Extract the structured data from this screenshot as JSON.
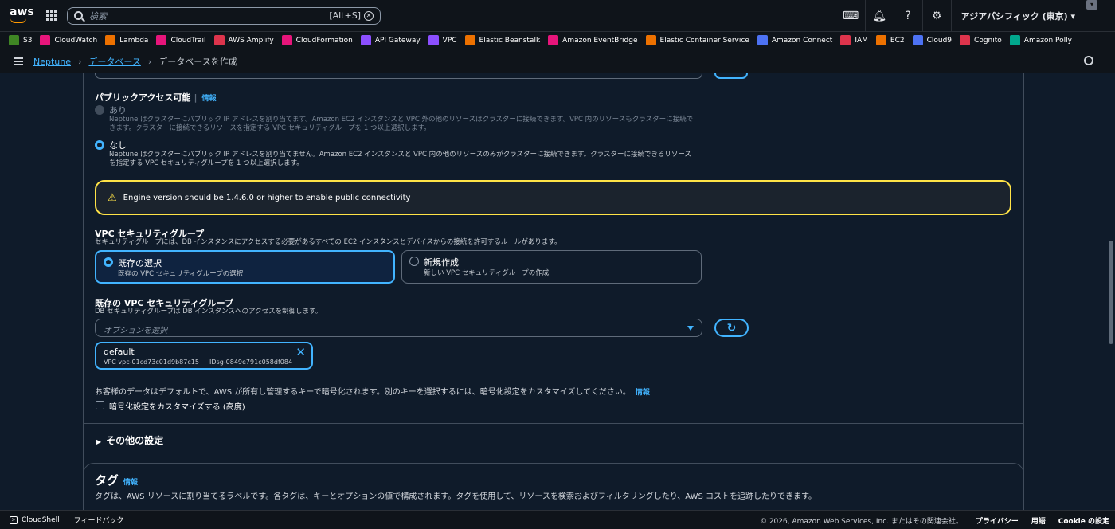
{
  "topnav": {
    "logo": "aws",
    "search_placeholder": "検索",
    "search_shortcut": "[Alt+S]",
    "region": "アジアパシフィック (東京) ▾",
    "icons": [
      "cloudshell-icon",
      "bell-icon",
      "help-icon",
      "gear-icon"
    ]
  },
  "favorites": [
    {
      "label": "S3",
      "color": "#3f8624"
    },
    {
      "label": "CloudWatch",
      "color": "#e7157b"
    },
    {
      "label": "Lambda",
      "color": "#ed7100"
    },
    {
      "label": "CloudTrail",
      "color": "#e7157b"
    },
    {
      "label": "AWS Amplify",
      "color": "#dd344c"
    },
    {
      "label": "CloudFormation",
      "color": "#e7157b"
    },
    {
      "label": "API Gateway",
      "color": "#8c4fff"
    },
    {
      "label": "VPC",
      "color": "#8c4fff"
    },
    {
      "label": "Elastic Beanstalk",
      "color": "#ed7100"
    },
    {
      "label": "Amazon EventBridge",
      "color": "#e7157b"
    },
    {
      "label": "Elastic Container Service",
      "color": "#ed7100"
    },
    {
      "label": "Amazon Connect",
      "color": "#4d72f3"
    },
    {
      "label": "IAM",
      "color": "#dd344c"
    },
    {
      "label": "EC2",
      "color": "#ed7100"
    },
    {
      "label": "Cloud9",
      "color": "#4d72f3"
    },
    {
      "label": "Cognito",
      "color": "#dd344c"
    },
    {
      "label": "Amazon Polly",
      "color": "#01a88d"
    }
  ],
  "breadcrumb": {
    "items": [
      "Neptune",
      "データベース"
    ],
    "current": "データベースを作成"
  },
  "public_access": {
    "label": "パブリックアクセス可能",
    "info": "情報",
    "yes_title": "あり",
    "yes_desc_1": "Neptune はクラスターにパブリック IP アドレスを割り当てます。Amazon EC2 インスタンスと VPC 外の他のリソースはクラスターに接続できます。VPC 内のリソースもクラスターに接続で",
    "yes_desc_2": "きます。クラスターに接続できるリソースを指定する VPC セキュリティグループを 1 つ以上選択します。",
    "no_title": "なし",
    "no_desc_1": "Neptune はクラスターにパブリック IP アドレスを割り当てません。Amazon EC2 インスタンスと VPC 内の他のリソースのみがクラスターに接続できます。クラスターに接続できるリソース",
    "no_desc_2": "を指定する VPC セキュリティグループを 1 つ以上選択します。",
    "selected": "なし"
  },
  "warning": {
    "text": "Engine version should be 1.4.6.0 or higher to enable public connectivity"
  },
  "vpc_sg": {
    "label": "VPC セキュリティグループ",
    "desc": "セキュリティグループには、DB インスタンスにアクセスする必要があるすべての EC2 インスタンスとデバイスからの接続を許可するルールがあります。",
    "existing_title": "既存の選択",
    "existing_desc": "既存の VPC セキュリティグループの選択",
    "new_title": "新規作成",
    "new_desc": "新しい VPC セキュリティグループの作成",
    "selected": "既存の選択"
  },
  "existing_sg": {
    "label": "既存の VPC セキュリティグループ",
    "desc": "DB セキュリティグループは DB インスタンスへのアクセスを制御します。",
    "placeholder": "オプションを選択",
    "token_name": "default",
    "token_vpc": "VPC vpc-01cd73c01d9b87c15",
    "token_id": "IDsg-0849e791c058df084"
  },
  "encryption": {
    "text": "お客様のデータはデフォルトで、AWS が所有し管理するキーで暗号化されます。別のキーを選択するには、暗号化設定をカスタマイズしてください。",
    "info": "情報",
    "checkbox_label": "暗号化設定をカスタマイズする (高度)",
    "checked": false
  },
  "other_settings": "その他の設定",
  "tags": {
    "title": "タグ",
    "info": "情報",
    "desc": "タグは、AWS リソースに割り当てるラベルです。各タグは、キーとオプションの値で構成されます。タグを使用して、リソースを検索およびフィルタリングしたり、AWS コストを追跡したりできます。"
  },
  "footer": {
    "cloudshell": "CloudShell",
    "feedback": "フィードバック",
    "copyright": "© 2026, Amazon Web Services, Inc. またはその関連会社。",
    "privacy": "プライバシー",
    "terms": "用語",
    "cookie": "Cookie の設定"
  }
}
